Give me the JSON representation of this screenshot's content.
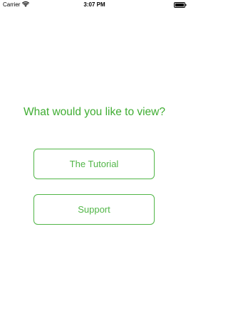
{
  "status_bar": {
    "carrier": "Carrier",
    "time": "3:07 PM",
    "wifi_icon": "wifi-icon",
    "battery_icon": "battery-full-icon"
  },
  "main": {
    "question": "What would you like to view?",
    "buttons": [
      {
        "label": "The Tutorial"
      },
      {
        "label": "Support"
      }
    ]
  },
  "colors": {
    "accent": "#3fad32",
    "button_border": "#52b648",
    "background": "#ffffff"
  }
}
